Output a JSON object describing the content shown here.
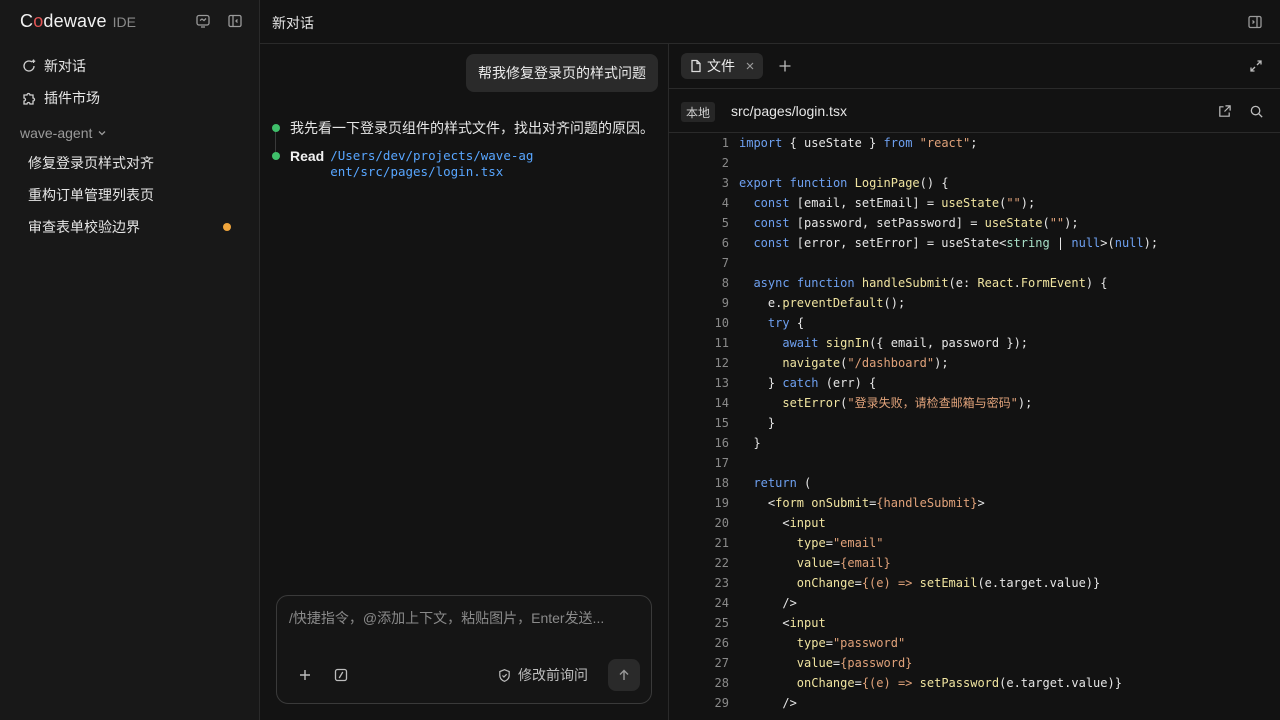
{
  "brand": {
    "name_prefix": "C",
    "name_o": "o",
    "name_suffix": "dewave",
    "suffix": "IDE"
  },
  "sidebar": {
    "nav": [
      {
        "label": "新对话",
        "icon": "new-chat-icon"
      },
      {
        "label": "插件市场",
        "icon": "puzzle-icon"
      }
    ],
    "group": {
      "label": "wave-agent"
    },
    "conversations": [
      {
        "label": "修复登录页样式对齐",
        "unread": false
      },
      {
        "label": "重构订单管理列表页",
        "unread": false
      },
      {
        "label": "审查表单校验边界",
        "unread": true
      }
    ]
  },
  "header": {
    "title": "新对话"
  },
  "chat": {
    "user_message": "帮我修复登录页的样式问题",
    "assistant_text": "我先看一下登录页组件的样式文件，找出对齐问题的原因。",
    "tool_label": "Read",
    "tool_path": "/Users/dev/projects/wave-agent/src/pages/login.tsx",
    "composer": {
      "placeholder": "/快捷指令，@添加上下文，粘贴图片，Enter发送...",
      "mode_label": "修改前询问"
    }
  },
  "editor": {
    "tab_label": "文件",
    "location_badge": "本地",
    "file_path": "src/pages/login.tsx",
    "code_lines": [
      {
        "n": "1",
        "html": "<span class='k'>import</span> { useState } <span class='k'>from</span> <span class='s'>\"react\"</span>;"
      },
      {
        "n": "2",
        "html": ""
      },
      {
        "n": "3",
        "html": "<span class='k'>export</span> <span class='k'>function</span> <span class='f'>LoginPage</span>() {"
      },
      {
        "n": "4",
        "html": "  <span class='k'>const</span> [email, setEmail] = <span class='f'>useState</span>(<span class='s'>\"\"</span>);"
      },
      {
        "n": "5",
        "html": "  <span class='k'>const</span> [password, setPassword] = <span class='f'>useState</span>(<span class='s'>\"\"</span>);"
      },
      {
        "n": "6",
        "html": "  <span class='k'>const</span> [error, setError] = useState&lt;<span class='t'>string</span> | <span class='k'>null</span>&gt;(<span class='k'>null</span>);"
      },
      {
        "n": "7",
        "html": ""
      },
      {
        "n": "8",
        "html": "  <span class='k'>async</span> <span class='k'>function</span> <span class='f'>handleSubmit</span>(e: <span class='f'>React</span>.<span class='f'>FormEvent</span>) {"
      },
      {
        "n": "9",
        "html": "    e.<span class='f'>preventDefault</span>();"
      },
      {
        "n": "10",
        "html": "    <span class='k'>try</span> {"
      },
      {
        "n": "11",
        "html": "      <span class='k'>await</span> <span class='f'>signIn</span>({ email, password });"
      },
      {
        "n": "12",
        "html": "      <span class='f'>navigate</span>(<span class='s'>\"/dashboard\"</span>);"
      },
      {
        "n": "13",
        "html": "    } <span class='k'>catch</span> (err) {"
      },
      {
        "n": "14",
        "html": "      <span class='f'>setError</span>(<span class='s'>\"登录失败，请检查邮箱与密码\"</span>);"
      },
      {
        "n": "15",
        "html": "    }"
      },
      {
        "n": "16",
        "html": "  }"
      },
      {
        "n": "17",
        "html": ""
      },
      {
        "n": "18",
        "html": "  <span class='k'>return</span> ("
      },
      {
        "n": "19",
        "html": "    &lt;<span class='f'>form</span> <span class='f'>onSubmit</span>=<span class='s'>{handleSubmit}</span>&gt;"
      },
      {
        "n": "20",
        "html": "      &lt;<span class='f'>input</span>"
      },
      {
        "n": "21",
        "html": "        <span class='f'>type</span>=<span class='s'>\"email\"</span>"
      },
      {
        "n": "22",
        "html": "        <span class='f'>value</span>=<span class='s'>{email}</span>"
      },
      {
        "n": "23",
        "html": "        <span class='f'>onChange</span>=<span class='s'>{(e) =&gt;</span> <span class='f'>setEmail</span>(e.target.value)}"
      },
      {
        "n": "24",
        "html": "      /&gt;"
      },
      {
        "n": "25",
        "html": "      &lt;<span class='f'>input</span>"
      },
      {
        "n": "26",
        "html": "        <span class='f'>type</span>=<span class='s'>\"password\"</span>"
      },
      {
        "n": "27",
        "html": "        <span class='f'>value</span>=<span class='s'>{password}</span>"
      },
      {
        "n": "28",
        "html": "        <span class='f'>onChange</span>=<span class='s'>{(e) =&gt;</span> <span class='f'>setPassword</span>(e.target.value)}"
      },
      {
        "n": "29",
        "html": "      /&gt;"
      }
    ]
  },
  "colors": {
    "accent_dot": "#3fbf6a",
    "unread_dot": "#f0a53c",
    "link": "#58a6ff",
    "brand_o": "#e05555"
  }
}
